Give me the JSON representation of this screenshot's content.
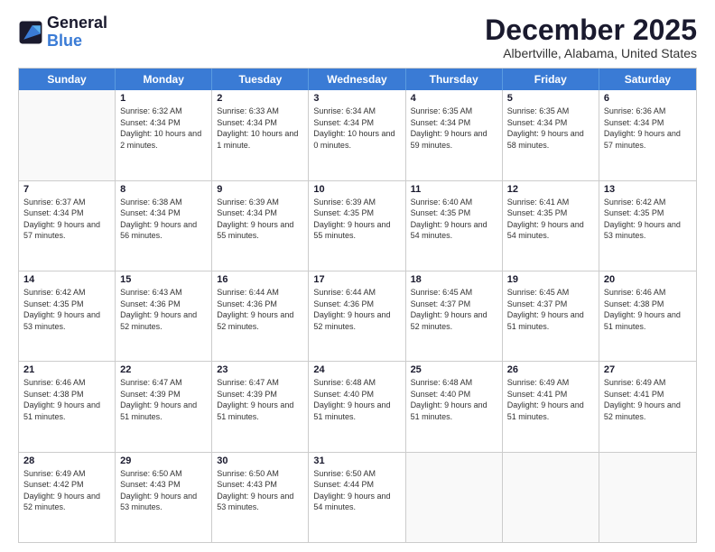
{
  "logo": {
    "line1": "General",
    "line2": "Blue"
  },
  "title": "December 2025",
  "location": "Albertville, Alabama, United States",
  "weekdays": [
    "Sunday",
    "Monday",
    "Tuesday",
    "Wednesday",
    "Thursday",
    "Friday",
    "Saturday"
  ],
  "rows": [
    [
      {
        "day": "",
        "empty": true
      },
      {
        "day": "1",
        "sunrise": "6:32 AM",
        "sunset": "4:34 PM",
        "daylight": "10 hours and 2 minutes."
      },
      {
        "day": "2",
        "sunrise": "6:33 AM",
        "sunset": "4:34 PM",
        "daylight": "10 hours and 1 minute."
      },
      {
        "day": "3",
        "sunrise": "6:34 AM",
        "sunset": "4:34 PM",
        "daylight": "10 hours and 0 minutes."
      },
      {
        "day": "4",
        "sunrise": "6:35 AM",
        "sunset": "4:34 PM",
        "daylight": "9 hours and 59 minutes."
      },
      {
        "day": "5",
        "sunrise": "6:35 AM",
        "sunset": "4:34 PM",
        "daylight": "9 hours and 58 minutes."
      },
      {
        "day": "6",
        "sunrise": "6:36 AM",
        "sunset": "4:34 PM",
        "daylight": "9 hours and 57 minutes."
      }
    ],
    [
      {
        "day": "7",
        "sunrise": "6:37 AM",
        "sunset": "4:34 PM",
        "daylight": "9 hours and 57 minutes."
      },
      {
        "day": "8",
        "sunrise": "6:38 AM",
        "sunset": "4:34 PM",
        "daylight": "9 hours and 56 minutes."
      },
      {
        "day": "9",
        "sunrise": "6:39 AM",
        "sunset": "4:34 PM",
        "daylight": "9 hours and 55 minutes."
      },
      {
        "day": "10",
        "sunrise": "6:39 AM",
        "sunset": "4:35 PM",
        "daylight": "9 hours and 55 minutes."
      },
      {
        "day": "11",
        "sunrise": "6:40 AM",
        "sunset": "4:35 PM",
        "daylight": "9 hours and 54 minutes."
      },
      {
        "day": "12",
        "sunrise": "6:41 AM",
        "sunset": "4:35 PM",
        "daylight": "9 hours and 54 minutes."
      },
      {
        "day": "13",
        "sunrise": "6:42 AM",
        "sunset": "4:35 PM",
        "daylight": "9 hours and 53 minutes."
      }
    ],
    [
      {
        "day": "14",
        "sunrise": "6:42 AM",
        "sunset": "4:35 PM",
        "daylight": "9 hours and 53 minutes."
      },
      {
        "day": "15",
        "sunrise": "6:43 AM",
        "sunset": "4:36 PM",
        "daylight": "9 hours and 52 minutes."
      },
      {
        "day": "16",
        "sunrise": "6:44 AM",
        "sunset": "4:36 PM",
        "daylight": "9 hours and 52 minutes."
      },
      {
        "day": "17",
        "sunrise": "6:44 AM",
        "sunset": "4:36 PM",
        "daylight": "9 hours and 52 minutes."
      },
      {
        "day": "18",
        "sunrise": "6:45 AM",
        "sunset": "4:37 PM",
        "daylight": "9 hours and 52 minutes."
      },
      {
        "day": "19",
        "sunrise": "6:45 AM",
        "sunset": "4:37 PM",
        "daylight": "9 hours and 51 minutes."
      },
      {
        "day": "20",
        "sunrise": "6:46 AM",
        "sunset": "4:38 PM",
        "daylight": "9 hours and 51 minutes."
      }
    ],
    [
      {
        "day": "21",
        "sunrise": "6:46 AM",
        "sunset": "4:38 PM",
        "daylight": "9 hours and 51 minutes."
      },
      {
        "day": "22",
        "sunrise": "6:47 AM",
        "sunset": "4:39 PM",
        "daylight": "9 hours and 51 minutes."
      },
      {
        "day": "23",
        "sunrise": "6:47 AM",
        "sunset": "4:39 PM",
        "daylight": "9 hours and 51 minutes."
      },
      {
        "day": "24",
        "sunrise": "6:48 AM",
        "sunset": "4:40 PM",
        "daylight": "9 hours and 51 minutes."
      },
      {
        "day": "25",
        "sunrise": "6:48 AM",
        "sunset": "4:40 PM",
        "daylight": "9 hours and 51 minutes."
      },
      {
        "day": "26",
        "sunrise": "6:49 AM",
        "sunset": "4:41 PM",
        "daylight": "9 hours and 51 minutes."
      },
      {
        "day": "27",
        "sunrise": "6:49 AM",
        "sunset": "4:41 PM",
        "daylight": "9 hours and 52 minutes."
      }
    ],
    [
      {
        "day": "28",
        "sunrise": "6:49 AM",
        "sunset": "4:42 PM",
        "daylight": "9 hours and 52 minutes."
      },
      {
        "day": "29",
        "sunrise": "6:50 AM",
        "sunset": "4:43 PM",
        "daylight": "9 hours and 53 minutes."
      },
      {
        "day": "30",
        "sunrise": "6:50 AM",
        "sunset": "4:43 PM",
        "daylight": "9 hours and 53 minutes."
      },
      {
        "day": "31",
        "sunrise": "6:50 AM",
        "sunset": "4:44 PM",
        "daylight": "9 hours and 54 minutes."
      },
      {
        "day": "",
        "empty": true
      },
      {
        "day": "",
        "empty": true
      },
      {
        "day": "",
        "empty": true
      }
    ]
  ]
}
